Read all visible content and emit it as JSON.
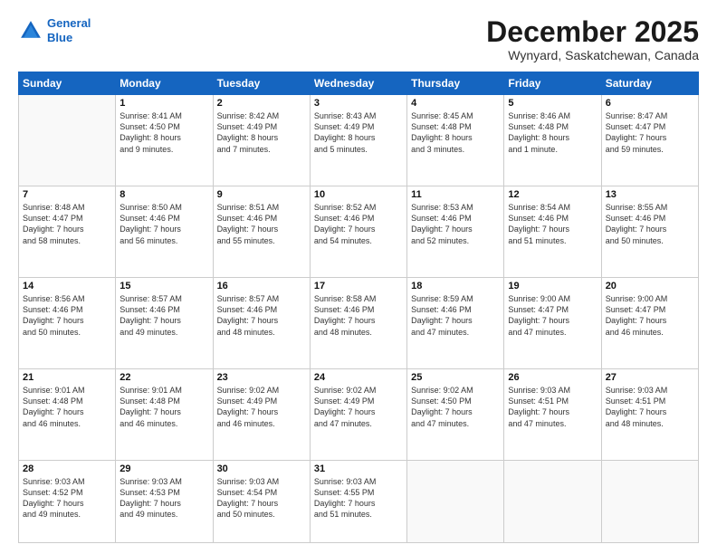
{
  "header": {
    "logo_line1": "General",
    "logo_line2": "Blue",
    "month_title": "December 2025",
    "location": "Wynyard, Saskatchewan, Canada"
  },
  "weekdays": [
    "Sunday",
    "Monday",
    "Tuesday",
    "Wednesday",
    "Thursday",
    "Friday",
    "Saturday"
  ],
  "weeks": [
    [
      {
        "day": "",
        "info": ""
      },
      {
        "day": "1",
        "info": "Sunrise: 8:41 AM\nSunset: 4:50 PM\nDaylight: 8 hours\nand 9 minutes."
      },
      {
        "day": "2",
        "info": "Sunrise: 8:42 AM\nSunset: 4:49 PM\nDaylight: 8 hours\nand 7 minutes."
      },
      {
        "day": "3",
        "info": "Sunrise: 8:43 AM\nSunset: 4:49 PM\nDaylight: 8 hours\nand 5 minutes."
      },
      {
        "day": "4",
        "info": "Sunrise: 8:45 AM\nSunset: 4:48 PM\nDaylight: 8 hours\nand 3 minutes."
      },
      {
        "day": "5",
        "info": "Sunrise: 8:46 AM\nSunset: 4:48 PM\nDaylight: 8 hours\nand 1 minute."
      },
      {
        "day": "6",
        "info": "Sunrise: 8:47 AM\nSunset: 4:47 PM\nDaylight: 7 hours\nand 59 minutes."
      }
    ],
    [
      {
        "day": "7",
        "info": "Sunrise: 8:48 AM\nSunset: 4:47 PM\nDaylight: 7 hours\nand 58 minutes."
      },
      {
        "day": "8",
        "info": "Sunrise: 8:50 AM\nSunset: 4:46 PM\nDaylight: 7 hours\nand 56 minutes."
      },
      {
        "day": "9",
        "info": "Sunrise: 8:51 AM\nSunset: 4:46 PM\nDaylight: 7 hours\nand 55 minutes."
      },
      {
        "day": "10",
        "info": "Sunrise: 8:52 AM\nSunset: 4:46 PM\nDaylight: 7 hours\nand 54 minutes."
      },
      {
        "day": "11",
        "info": "Sunrise: 8:53 AM\nSunset: 4:46 PM\nDaylight: 7 hours\nand 52 minutes."
      },
      {
        "day": "12",
        "info": "Sunrise: 8:54 AM\nSunset: 4:46 PM\nDaylight: 7 hours\nand 51 minutes."
      },
      {
        "day": "13",
        "info": "Sunrise: 8:55 AM\nSunset: 4:46 PM\nDaylight: 7 hours\nand 50 minutes."
      }
    ],
    [
      {
        "day": "14",
        "info": "Sunrise: 8:56 AM\nSunset: 4:46 PM\nDaylight: 7 hours\nand 50 minutes."
      },
      {
        "day": "15",
        "info": "Sunrise: 8:57 AM\nSunset: 4:46 PM\nDaylight: 7 hours\nand 49 minutes."
      },
      {
        "day": "16",
        "info": "Sunrise: 8:57 AM\nSunset: 4:46 PM\nDaylight: 7 hours\nand 48 minutes."
      },
      {
        "day": "17",
        "info": "Sunrise: 8:58 AM\nSunset: 4:46 PM\nDaylight: 7 hours\nand 48 minutes."
      },
      {
        "day": "18",
        "info": "Sunrise: 8:59 AM\nSunset: 4:46 PM\nDaylight: 7 hours\nand 47 minutes."
      },
      {
        "day": "19",
        "info": "Sunrise: 9:00 AM\nSunset: 4:47 PM\nDaylight: 7 hours\nand 47 minutes."
      },
      {
        "day": "20",
        "info": "Sunrise: 9:00 AM\nSunset: 4:47 PM\nDaylight: 7 hours\nand 46 minutes."
      }
    ],
    [
      {
        "day": "21",
        "info": "Sunrise: 9:01 AM\nSunset: 4:48 PM\nDaylight: 7 hours\nand 46 minutes."
      },
      {
        "day": "22",
        "info": "Sunrise: 9:01 AM\nSunset: 4:48 PM\nDaylight: 7 hours\nand 46 minutes."
      },
      {
        "day": "23",
        "info": "Sunrise: 9:02 AM\nSunset: 4:49 PM\nDaylight: 7 hours\nand 46 minutes."
      },
      {
        "day": "24",
        "info": "Sunrise: 9:02 AM\nSunset: 4:49 PM\nDaylight: 7 hours\nand 47 minutes."
      },
      {
        "day": "25",
        "info": "Sunrise: 9:02 AM\nSunset: 4:50 PM\nDaylight: 7 hours\nand 47 minutes."
      },
      {
        "day": "26",
        "info": "Sunrise: 9:03 AM\nSunset: 4:51 PM\nDaylight: 7 hours\nand 47 minutes."
      },
      {
        "day": "27",
        "info": "Sunrise: 9:03 AM\nSunset: 4:51 PM\nDaylight: 7 hours\nand 48 minutes."
      }
    ],
    [
      {
        "day": "28",
        "info": "Sunrise: 9:03 AM\nSunset: 4:52 PM\nDaylight: 7 hours\nand 49 minutes."
      },
      {
        "day": "29",
        "info": "Sunrise: 9:03 AM\nSunset: 4:53 PM\nDaylight: 7 hours\nand 49 minutes."
      },
      {
        "day": "30",
        "info": "Sunrise: 9:03 AM\nSunset: 4:54 PM\nDaylight: 7 hours\nand 50 minutes."
      },
      {
        "day": "31",
        "info": "Sunrise: 9:03 AM\nSunset: 4:55 PM\nDaylight: 7 hours\nand 51 minutes."
      },
      {
        "day": "",
        "info": ""
      },
      {
        "day": "",
        "info": ""
      },
      {
        "day": "",
        "info": ""
      }
    ]
  ]
}
